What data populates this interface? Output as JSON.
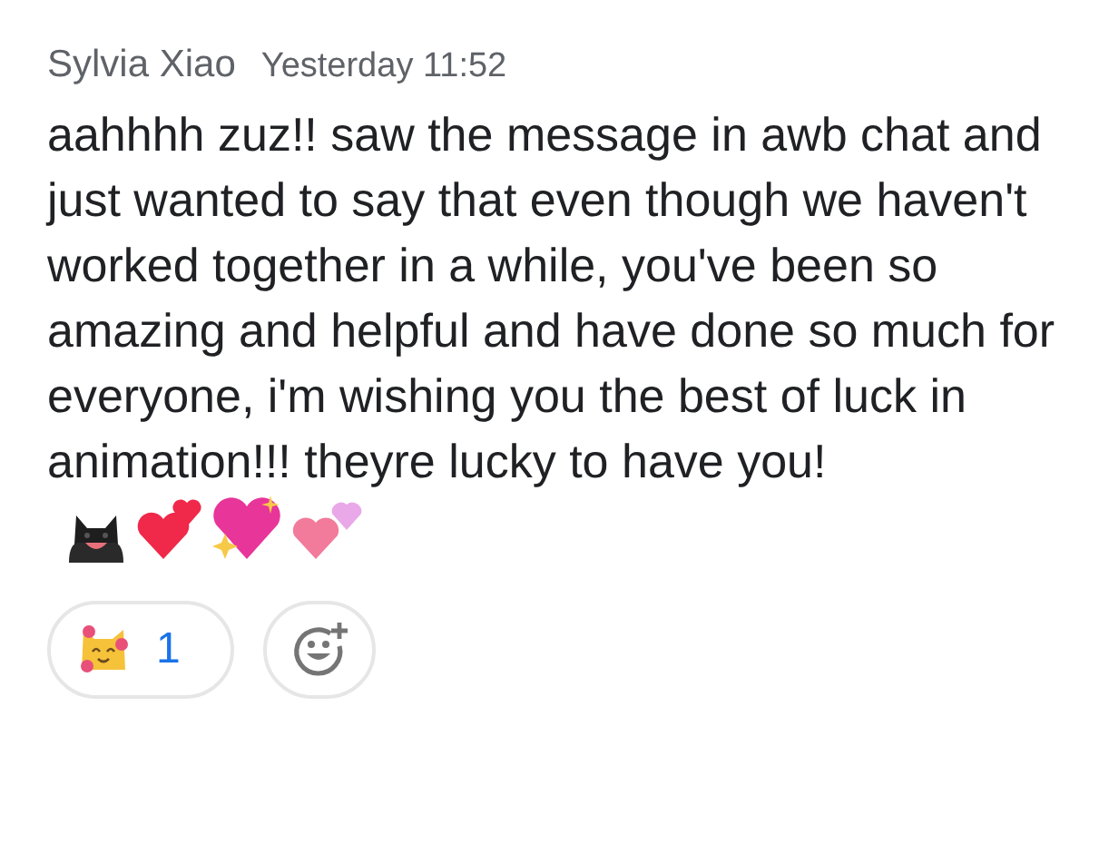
{
  "message": {
    "author": "Sylvia Xiao",
    "time": "Yesterday 11:52",
    "text": "aahhhh zuz!! saw the message in awb chat and just wanted to say that even though we haven't worked together in a while, you've been so amazing and helpful and have done so much for everyone, i'm wishing you the best of luck in animation!!! theyre lucky to have you!",
    "reactions": [
      {
        "count": "1"
      }
    ]
  }
}
